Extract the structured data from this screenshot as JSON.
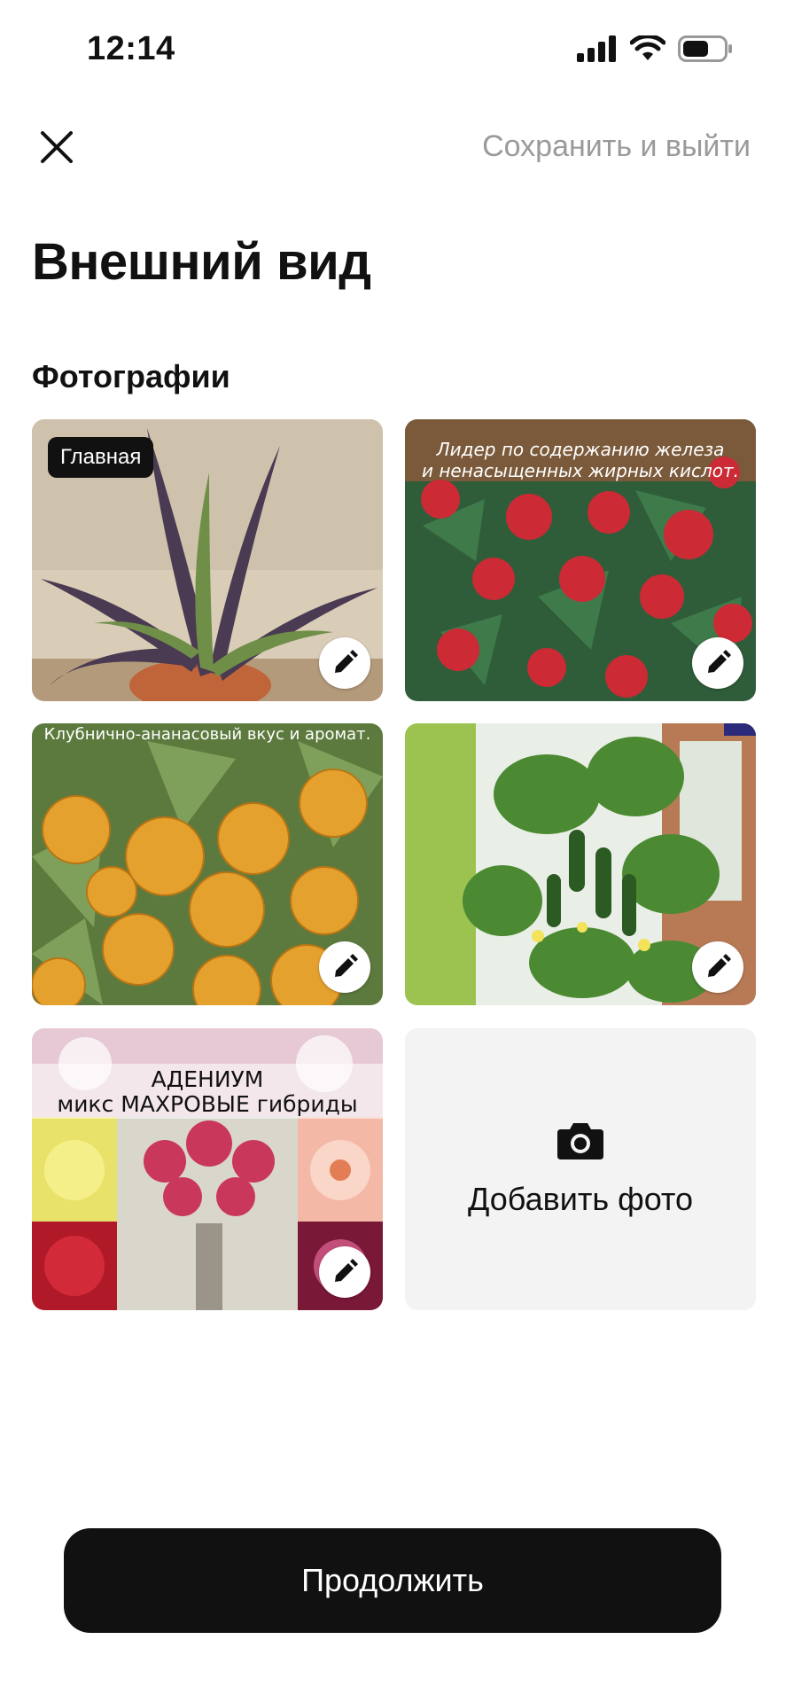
{
  "status_bar": {
    "time": "12:14"
  },
  "header": {
    "close_icon": "close-icon",
    "save_exit_label": "Сохранить и выйти"
  },
  "page_title": "Внешний вид",
  "section_title": "Фотографии",
  "photos": [
    {
      "badge": "Главная",
      "subject": "purple tradescantia plant",
      "edit_icon": "pencil-icon"
    },
    {
      "caption": "Лидер по содержанию железа и ненасыщенных жирных кислот.",
      "caption_line1": "Лидер по содержанию железа",
      "caption_line2": "и ненасыщенных жирных кислот.",
      "subject": "red berries",
      "edit_icon": "pencil-icon"
    },
    {
      "caption": "Клубнично-ананасовый вкус и аромат.",
      "subject": "orange physalis fruits",
      "edit_icon": "pencil-icon"
    },
    {
      "subject": "cucumbers on vine",
      "edit_icon": "pencil-icon"
    },
    {
      "caption_line1": "АДЕНИУМ",
      "caption_line2": "микс МАХРОВЫЕ гибриды",
      "subject": "adenium flowers",
      "edit_icon": "pencil-icon"
    }
  ],
  "add_photo": {
    "label": "Добавить фото",
    "icon": "camera-icon"
  },
  "continue_label": "Продолжить",
  "colors": {
    "primary": "#111111",
    "muted": "#9a9a9a",
    "tile_bg": "#f3f3f3"
  }
}
